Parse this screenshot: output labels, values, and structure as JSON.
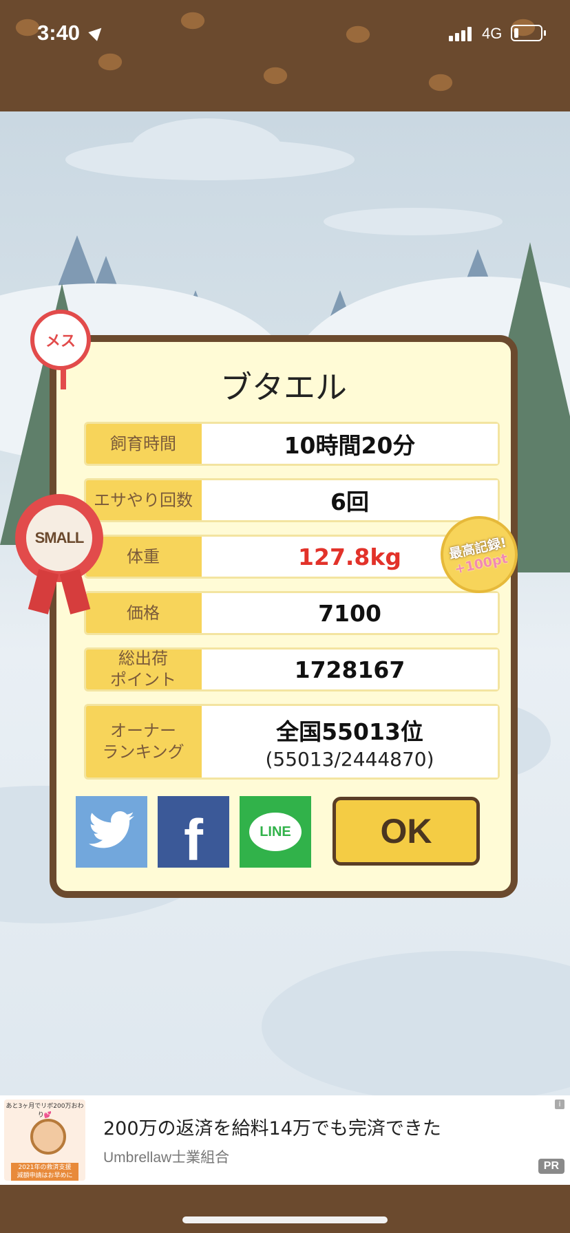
{
  "status_bar": {
    "time": "3:40",
    "network": "4G"
  },
  "dialog": {
    "title": "ブタエル",
    "rows": [
      {
        "label": "飼育時間",
        "value": "10時間20分"
      },
      {
        "label": "エサやり回数",
        "value": "6回"
      },
      {
        "label": "体重",
        "value": "127.8kg"
      },
      {
        "label": "価格",
        "value": "7100"
      },
      {
        "label": "総出荷\nポイント",
        "value": "1728167"
      },
      {
        "label": "オーナー\nランキング",
        "value": "全国55013位",
        "sub": "(55013/2444870)"
      }
    ],
    "buttons": {
      "twitter_icon": "twitter-bird-icon",
      "facebook_label": "f",
      "line_label": "LINE",
      "ok_label": "OK"
    },
    "badges": {
      "female": "メス",
      "size": "SMALL",
      "record_line1": "最高記録!",
      "record_line2": "+100pt"
    }
  },
  "ad": {
    "thumb_top": "あと3ヶ月でリボ200万おわり💕",
    "thumb_bottom": "2021年の救済支援\n減額申請はお早めに",
    "headline": "200万の返済を給料14万でも完済できた",
    "source": "Umbrellaw士業組合",
    "pr": "PR",
    "info": "i"
  },
  "colors": {
    "brown": "#6b4a2e",
    "panel": "#fffbd6",
    "label_bg": "#f7d45a",
    "weight_red": "#e2322a",
    "twitter": "#72a7dc",
    "facebook": "#3b5998",
    "line": "#31b24a"
  }
}
